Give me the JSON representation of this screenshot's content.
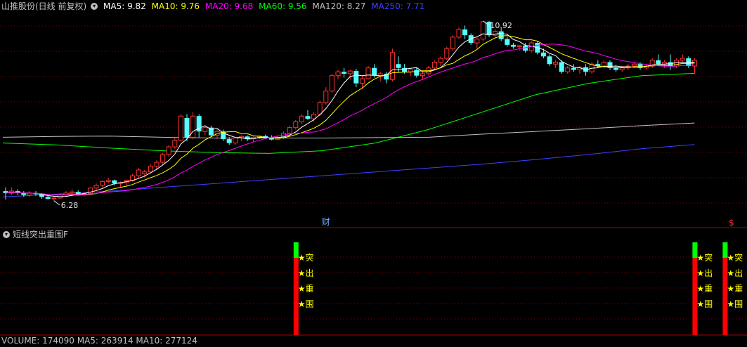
{
  "header": {
    "title": "山推股份(日线 前复权)",
    "ma": [
      {
        "label": "MA5: 9.82",
        "color": "#ffffff"
      },
      {
        "label": "MA10: 9.76",
        "color": "#ffff00"
      },
      {
        "label": "MA20: 9.68",
        "color": "#ff00ff"
      },
      {
        "label": "MA60: 9.56",
        "color": "#00ff00"
      },
      {
        "label": "MA120: 8.27",
        "color": "#c0c0c0"
      },
      {
        "label": "MA250: 7.71",
        "color": "#4040ff"
      }
    ]
  },
  "sub_panel": {
    "title": "短线突出重围F",
    "star_chars": [
      "★突",
      "★出",
      "★重",
      "★围"
    ]
  },
  "volume_header": {
    "text": "VOLUME: 174090 MA5: 263914 MA10: 277124"
  },
  "colors": {
    "up": "#ff3232",
    "down": "#54ffff",
    "signal_red": "#ff0000",
    "signal_green": "#00ff00",
    "star": "#ffff00",
    "divider": "#b00000"
  },
  "chart_data": {
    "type": "candlestick",
    "ylim": [
      5.9,
      11.1
    ],
    "markers": {
      "high": "10.92",
      "low": "6.28",
      "cai": "财",
      "sign": "$"
    },
    "ohlc": [
      [
        6.5,
        6.6,
        6.28,
        6.45
      ],
      [
        6.45,
        6.6,
        6.4,
        6.5
      ],
      [
        6.5,
        6.55,
        6.4,
        6.45
      ],
      [
        6.45,
        6.5,
        6.35,
        6.4
      ],
      [
        6.4,
        6.5,
        6.35,
        6.45
      ],
      [
        6.45,
        6.5,
        6.38,
        6.42
      ],
      [
        6.42,
        6.45,
        6.3,
        6.35
      ],
      [
        6.35,
        6.4,
        6.28,
        6.3
      ],
      [
        6.3,
        6.38,
        6.25,
        6.32
      ],
      [
        6.32,
        6.45,
        6.3,
        6.4
      ],
      [
        6.4,
        6.5,
        6.35,
        6.45
      ],
      [
        6.45,
        6.55,
        6.38,
        6.48
      ],
      [
        6.48,
        6.52,
        6.4,
        6.42
      ],
      [
        6.42,
        6.48,
        6.38,
        6.44
      ],
      [
        6.44,
        6.6,
        6.42,
        6.58
      ],
      [
        6.58,
        6.7,
        6.5,
        6.65
      ],
      [
        6.65,
        6.78,
        6.6,
        6.75
      ],
      [
        6.75,
        6.85,
        6.7,
        6.78
      ],
      [
        6.78,
        6.8,
        6.65,
        6.7
      ],
      [
        6.7,
        6.75,
        6.6,
        6.72
      ],
      [
        6.72,
        6.8,
        6.65,
        6.78
      ],
      [
        6.78,
        6.95,
        6.75,
        6.9
      ],
      [
        6.9,
        7.1,
        6.85,
        7.05
      ],
      [
        6.95,
        7.05,
        6.85,
        7.0
      ],
      [
        7.0,
        7.2,
        6.95,
        7.15
      ],
      [
        7.15,
        7.3,
        7.05,
        7.25
      ],
      [
        7.25,
        7.5,
        7.2,
        7.45
      ],
      [
        7.45,
        7.7,
        7.4,
        7.65
      ],
      [
        7.65,
        7.9,
        7.6,
        7.82
      ],
      [
        7.82,
        8.5,
        7.8,
        8.45
      ],
      [
        8.4,
        8.5,
        7.8,
        7.9
      ],
      [
        7.9,
        8.55,
        7.85,
        8.45
      ],
      [
        8.45,
        8.5,
        7.9,
        8.05
      ],
      [
        8.05,
        8.2,
        7.95,
        8.15
      ],
      [
        8.15,
        8.2,
        7.9,
        7.95
      ],
      [
        7.95,
        8.1,
        7.85,
        8.05
      ],
      [
        8.05,
        8.1,
        7.8,
        7.85
      ],
      [
        7.85,
        7.9,
        7.7,
        7.75
      ],
      [
        7.75,
        7.9,
        7.7,
        7.88
      ],
      [
        7.88,
        7.95,
        7.8,
        7.92
      ],
      [
        7.92,
        7.95,
        7.8,
        7.86
      ],
      [
        7.86,
        7.92,
        7.78,
        7.9
      ],
      [
        7.9,
        7.95,
        7.85,
        7.93
      ],
      [
        7.93,
        7.97,
        7.86,
        7.88
      ],
      [
        7.88,
        7.95,
        7.82,
        7.84
      ],
      [
        7.84,
        7.95,
        7.82,
        7.9
      ],
      [
        7.9,
        8.05,
        7.85,
        8.0
      ],
      [
        8.0,
        8.2,
        7.95,
        8.15
      ],
      [
        8.15,
        8.35,
        8.1,
        8.3
      ],
      [
        8.3,
        8.5,
        8.25,
        8.45
      ],
      [
        8.45,
        8.6,
        8.35,
        8.38
      ],
      [
        8.38,
        8.55,
        8.3,
        8.5
      ],
      [
        8.5,
        8.85,
        8.45,
        8.8
      ],
      [
        8.8,
        9.2,
        8.75,
        9.1
      ],
      [
        9.1,
        9.55,
        9.05,
        9.5
      ],
      [
        9.5,
        9.65,
        9.4,
        9.6
      ],
      [
        9.6,
        9.7,
        9.45,
        9.55
      ],
      [
        9.55,
        9.65,
        9.4,
        9.62
      ],
      [
        9.62,
        9.68,
        9.2,
        9.3
      ],
      [
        9.3,
        9.5,
        9.15,
        9.42
      ],
      [
        9.42,
        9.75,
        9.4,
        9.7
      ],
      [
        9.7,
        9.8,
        9.45,
        9.5
      ],
      [
        9.5,
        9.6,
        9.35,
        9.55
      ],
      [
        9.55,
        9.6,
        9.3,
        9.4
      ],
      [
        9.4,
        10.2,
        9.35,
        10.1
      ],
      [
        9.8,
        10.0,
        9.6,
        9.7
      ],
      [
        9.7,
        9.8,
        9.55,
        9.6
      ],
      [
        9.6,
        9.7,
        9.5,
        9.65
      ],
      [
        9.65,
        9.7,
        9.45,
        9.5
      ],
      [
        9.5,
        9.6,
        9.4,
        9.55
      ],
      [
        9.55,
        9.75,
        9.5,
        9.7
      ],
      [
        9.7,
        9.9,
        9.65,
        9.85
      ],
      [
        9.85,
        10.0,
        9.75,
        9.95
      ],
      [
        9.95,
        10.25,
        9.9,
        10.2
      ],
      [
        10.2,
        10.55,
        10.15,
        10.5
      ],
      [
        10.5,
        10.75,
        10.45,
        10.7
      ],
      [
        10.7,
        10.8,
        10.45,
        10.55
      ],
      [
        10.55,
        10.6,
        10.3,
        10.35
      ],
      [
        10.35,
        10.5,
        10.2,
        10.45
      ],
      [
        10.45,
        10.92,
        10.4,
        10.9
      ],
      [
        10.9,
        10.92,
        10.5,
        10.55
      ],
      [
        10.55,
        10.7,
        10.5,
        10.65
      ],
      [
        10.65,
        10.75,
        10.4,
        10.45
      ],
      [
        10.45,
        10.5,
        10.25,
        10.3
      ],
      [
        10.3,
        10.35,
        10.2,
        10.25
      ],
      [
        10.25,
        10.3,
        10.15,
        10.28
      ],
      [
        10.28,
        10.35,
        10.1,
        10.15
      ],
      [
        10.15,
        10.4,
        10.1,
        10.35
      ],
      [
        10.35,
        10.4,
        10.05,
        10.1
      ],
      [
        10.1,
        10.2,
        9.95,
        10.0
      ],
      [
        10.0,
        10.05,
        9.75,
        9.8
      ],
      [
        9.8,
        9.9,
        9.7,
        9.85
      ],
      [
        9.85,
        9.9,
        9.55,
        9.6
      ],
      [
        9.6,
        9.75,
        9.55,
        9.7
      ],
      [
        9.7,
        9.8,
        9.6,
        9.65
      ],
      [
        9.65,
        9.75,
        9.55,
        9.72
      ],
      [
        9.72,
        9.8,
        9.5,
        9.6
      ],
      [
        9.6,
        9.85,
        9.55,
        9.8
      ],
      [
        9.8,
        9.9,
        9.7,
        9.75
      ],
      [
        9.75,
        9.9,
        9.7,
        9.85
      ],
      [
        9.85,
        9.9,
        9.65,
        9.7
      ],
      [
        9.7,
        9.78,
        9.6,
        9.65
      ],
      [
        9.65,
        9.75,
        9.6,
        9.7
      ],
      [
        9.7,
        9.8,
        9.65,
        9.75
      ],
      [
        9.75,
        9.85,
        9.7,
        9.8
      ],
      [
        9.8,
        9.85,
        9.65,
        9.7
      ],
      [
        9.7,
        9.8,
        9.65,
        9.75
      ],
      [
        9.75,
        9.95,
        9.7,
        9.9
      ],
      [
        9.9,
        10.05,
        9.75,
        9.8
      ],
      [
        9.8,
        9.9,
        9.7,
        9.85
      ],
      [
        9.85,
        10.05,
        9.65,
        9.75
      ],
      [
        9.75,
        9.95,
        9.7,
        9.9
      ],
      [
        9.9,
        10.05,
        9.85,
        9.95
      ],
      [
        9.95,
        10.0,
        9.7,
        9.75
      ],
      [
        9.75,
        9.95,
        9.55,
        9.9
      ]
    ],
    "series": [
      {
        "name": "MA5",
        "color": "#ffffff"
      },
      {
        "name": "MA10",
        "color": "#ffff00"
      },
      {
        "name": "MA20",
        "color": "#ff00ff"
      },
      {
        "name": "MA60",
        "color": "#00ff00"
      },
      {
        "name": "MA120",
        "color": "#c0c0c0"
      },
      {
        "name": "MA250",
        "color": "#4040ff"
      }
    ],
    "ma60_values": [
      7.75,
      7.7,
      7.62,
      7.55,
      7.5,
      7.48,
      7.55,
      7.75,
      8.1,
      8.55,
      9.0,
      9.3,
      9.5,
      9.56
    ],
    "ma120_values": [
      7.9,
      7.92,
      7.93,
      7.9,
      7.88,
      7.88,
      7.88,
      7.89,
      7.9,
      7.98,
      8.05,
      8.12,
      8.2,
      8.27
    ],
    "ma250_values": [
      6.35,
      6.42,
      6.5,
      6.6,
      6.7,
      6.8,
      6.9,
      7.0,
      7.1,
      7.2,
      7.32,
      7.45,
      7.6,
      7.71
    ],
    "signal_bars": [
      {
        "candle": 48,
        "value": 1
      },
      {
        "candle": 114,
        "value": 1
      },
      {
        "candle": 119,
        "value": 1
      }
    ],
    "markers_index": {
      "cai_candle": 53,
      "sign_candle": 120
    }
  }
}
